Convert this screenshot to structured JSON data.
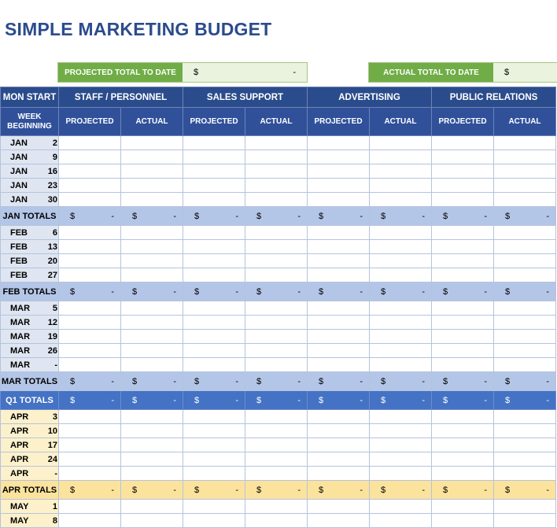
{
  "title": "SIMPLE MARKETING BUDGET",
  "summary": {
    "projected_label": "PROJECTED TOTAL TO DATE",
    "projected_currency": "$",
    "projected_value": "-",
    "actual_label": "ACTUAL TOTAL TO DATE",
    "actual_currency": "$",
    "actual_value": ""
  },
  "header": {
    "mon_start": "MON START",
    "week_beginning": "WEEK BEGINNING",
    "categories": [
      "STAFF / PERSONNEL",
      "SALES SUPPORT",
      "ADVERTISING",
      "PUBLIC RELATIONS"
    ],
    "projected": "PROJECTED",
    "actual": "ACTUAL"
  },
  "money": {
    "currency": "$",
    "dash": "-"
  },
  "rows": [
    {
      "type": "week",
      "month": "JAN",
      "day": "2"
    },
    {
      "type": "week",
      "month": "JAN",
      "day": "9"
    },
    {
      "type": "week",
      "month": "JAN",
      "day": "16"
    },
    {
      "type": "week",
      "month": "JAN",
      "day": "23"
    },
    {
      "type": "week",
      "month": "JAN",
      "day": "30"
    },
    {
      "type": "total",
      "label": "JAN TOTALS"
    },
    {
      "type": "week",
      "month": "FEB",
      "day": "6"
    },
    {
      "type": "week",
      "month": "FEB",
      "day": "13"
    },
    {
      "type": "week",
      "month": "FEB",
      "day": "20"
    },
    {
      "type": "week",
      "month": "FEB",
      "day": "27"
    },
    {
      "type": "total",
      "label": "FEB TOTALS"
    },
    {
      "type": "week",
      "month": "MAR",
      "day": "5"
    },
    {
      "type": "week",
      "month": "MAR",
      "day": "12"
    },
    {
      "type": "week",
      "month": "MAR",
      "day": "19"
    },
    {
      "type": "week",
      "month": "MAR",
      "day": "26"
    },
    {
      "type": "week",
      "month": "MAR",
      "day": "-"
    },
    {
      "type": "total",
      "label": "MAR TOTALS"
    },
    {
      "type": "quarter",
      "label": "Q1 TOTALS"
    },
    {
      "type": "week",
      "month": "APR",
      "day": "3",
      "theme": "yellow"
    },
    {
      "type": "week",
      "month": "APR",
      "day": "10",
      "theme": "yellow"
    },
    {
      "type": "week",
      "month": "APR",
      "day": "17",
      "theme": "yellow"
    },
    {
      "type": "week",
      "month": "APR",
      "day": "24",
      "theme": "yellow"
    },
    {
      "type": "week",
      "month": "APR",
      "day": "-",
      "theme": "yellow"
    },
    {
      "type": "total",
      "label": "APR TOTALS",
      "theme": "yellow"
    },
    {
      "type": "week",
      "month": "MAY",
      "day": "1",
      "theme": "yellow"
    },
    {
      "type": "week",
      "month": "MAY",
      "day": "8",
      "theme": "yellow"
    }
  ]
}
